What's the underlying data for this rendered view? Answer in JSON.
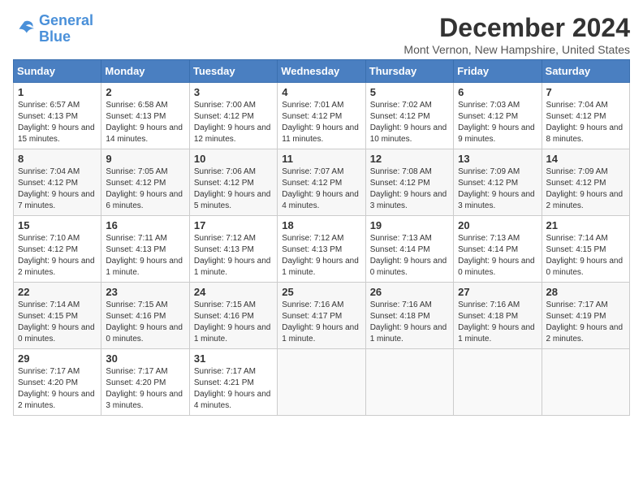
{
  "logo": {
    "line1": "General",
    "line2": "Blue"
  },
  "title": "December 2024",
  "location": "Mont Vernon, New Hampshire, United States",
  "days_header": [
    "Sunday",
    "Monday",
    "Tuesday",
    "Wednesday",
    "Thursday",
    "Friday",
    "Saturday"
  ],
  "weeks": [
    [
      {
        "day": "1",
        "sunrise": "6:57 AM",
        "sunset": "4:13 PM",
        "daylight": "9 hours and 15 minutes."
      },
      {
        "day": "2",
        "sunrise": "6:58 AM",
        "sunset": "4:13 PM",
        "daylight": "9 hours and 14 minutes."
      },
      {
        "day": "3",
        "sunrise": "7:00 AM",
        "sunset": "4:12 PM",
        "daylight": "9 hours and 12 minutes."
      },
      {
        "day": "4",
        "sunrise": "7:01 AM",
        "sunset": "4:12 PM",
        "daylight": "9 hours and 11 minutes."
      },
      {
        "day": "5",
        "sunrise": "7:02 AM",
        "sunset": "4:12 PM",
        "daylight": "9 hours and 10 minutes."
      },
      {
        "day": "6",
        "sunrise": "7:03 AM",
        "sunset": "4:12 PM",
        "daylight": "9 hours and 9 minutes."
      },
      {
        "day": "7",
        "sunrise": "7:04 AM",
        "sunset": "4:12 PM",
        "daylight": "9 hours and 8 minutes."
      }
    ],
    [
      {
        "day": "8",
        "sunrise": "7:04 AM",
        "sunset": "4:12 PM",
        "daylight": "9 hours and 7 minutes."
      },
      {
        "day": "9",
        "sunrise": "7:05 AM",
        "sunset": "4:12 PM",
        "daylight": "9 hours and 6 minutes."
      },
      {
        "day": "10",
        "sunrise": "7:06 AM",
        "sunset": "4:12 PM",
        "daylight": "9 hours and 5 minutes."
      },
      {
        "day": "11",
        "sunrise": "7:07 AM",
        "sunset": "4:12 PM",
        "daylight": "9 hours and 4 minutes."
      },
      {
        "day": "12",
        "sunrise": "7:08 AM",
        "sunset": "4:12 PM",
        "daylight": "9 hours and 3 minutes."
      },
      {
        "day": "13",
        "sunrise": "7:09 AM",
        "sunset": "4:12 PM",
        "daylight": "9 hours and 3 minutes."
      },
      {
        "day": "14",
        "sunrise": "7:09 AM",
        "sunset": "4:12 PM",
        "daylight": "9 hours and 2 minutes."
      }
    ],
    [
      {
        "day": "15",
        "sunrise": "7:10 AM",
        "sunset": "4:12 PM",
        "daylight": "9 hours and 2 minutes."
      },
      {
        "day": "16",
        "sunrise": "7:11 AM",
        "sunset": "4:13 PM",
        "daylight": "9 hours and 1 minute."
      },
      {
        "day": "17",
        "sunrise": "7:12 AM",
        "sunset": "4:13 PM",
        "daylight": "9 hours and 1 minute."
      },
      {
        "day": "18",
        "sunrise": "7:12 AM",
        "sunset": "4:13 PM",
        "daylight": "9 hours and 1 minute."
      },
      {
        "day": "19",
        "sunrise": "7:13 AM",
        "sunset": "4:14 PM",
        "daylight": "9 hours and 0 minutes."
      },
      {
        "day": "20",
        "sunrise": "7:13 AM",
        "sunset": "4:14 PM",
        "daylight": "9 hours and 0 minutes."
      },
      {
        "day": "21",
        "sunrise": "7:14 AM",
        "sunset": "4:15 PM",
        "daylight": "9 hours and 0 minutes."
      }
    ],
    [
      {
        "day": "22",
        "sunrise": "7:14 AM",
        "sunset": "4:15 PM",
        "daylight": "9 hours and 0 minutes."
      },
      {
        "day": "23",
        "sunrise": "7:15 AM",
        "sunset": "4:16 PM",
        "daylight": "9 hours and 0 minutes."
      },
      {
        "day": "24",
        "sunrise": "7:15 AM",
        "sunset": "4:16 PM",
        "daylight": "9 hours and 1 minute."
      },
      {
        "day": "25",
        "sunrise": "7:16 AM",
        "sunset": "4:17 PM",
        "daylight": "9 hours and 1 minute."
      },
      {
        "day": "26",
        "sunrise": "7:16 AM",
        "sunset": "4:18 PM",
        "daylight": "9 hours and 1 minute."
      },
      {
        "day": "27",
        "sunrise": "7:16 AM",
        "sunset": "4:18 PM",
        "daylight": "9 hours and 1 minute."
      },
      {
        "day": "28",
        "sunrise": "7:17 AM",
        "sunset": "4:19 PM",
        "daylight": "9 hours and 2 minutes."
      }
    ],
    [
      {
        "day": "29",
        "sunrise": "7:17 AM",
        "sunset": "4:20 PM",
        "daylight": "9 hours and 2 minutes."
      },
      {
        "day": "30",
        "sunrise": "7:17 AM",
        "sunset": "4:20 PM",
        "daylight": "9 hours and 3 minutes."
      },
      {
        "day": "31",
        "sunrise": "7:17 AM",
        "sunset": "4:21 PM",
        "daylight": "9 hours and 4 minutes."
      },
      null,
      null,
      null,
      null
    ]
  ]
}
